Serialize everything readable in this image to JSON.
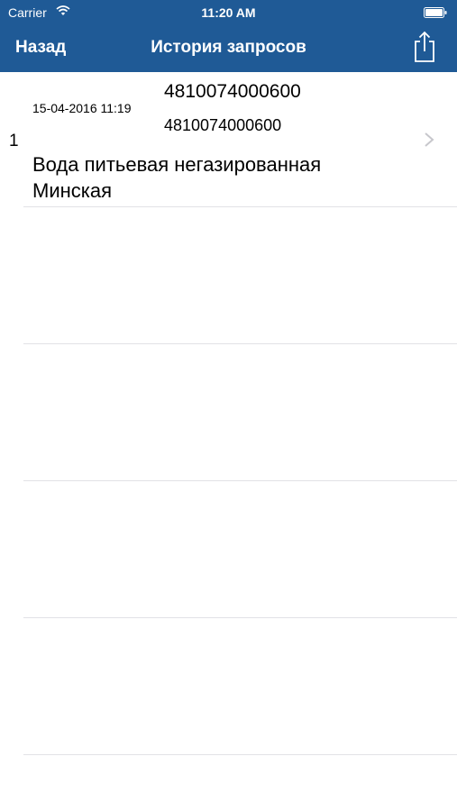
{
  "status_bar": {
    "carrier": "Carrier",
    "time": "11:20 AM"
  },
  "nav": {
    "back_label": "Назад",
    "title": "История запросов"
  },
  "history": [
    {
      "index": "1",
      "date": "15-04-2016 11:19",
      "code_primary": "4810074000600",
      "code_secondary": "4810074000600",
      "name": "Вода питьевая негазированная Минская"
    }
  ],
  "colors": {
    "nav_background": "#1f5a96",
    "nav_text": "#ffffff"
  }
}
